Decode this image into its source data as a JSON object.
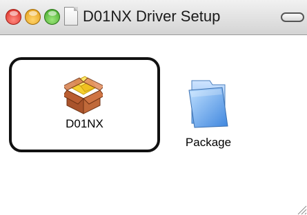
{
  "window": {
    "title": "D01NX Driver Setup"
  },
  "items": [
    {
      "label": "D01NX",
      "icon": "installer-package-icon",
      "selected": true
    },
    {
      "label": "Package",
      "icon": "folder-icon",
      "selected": false
    }
  ],
  "colors": {
    "close": "#d7261e",
    "minimize": "#e09b12",
    "zoom": "#3ea424",
    "selection_border": "#111111",
    "folder_blue": "#5a9be6"
  }
}
